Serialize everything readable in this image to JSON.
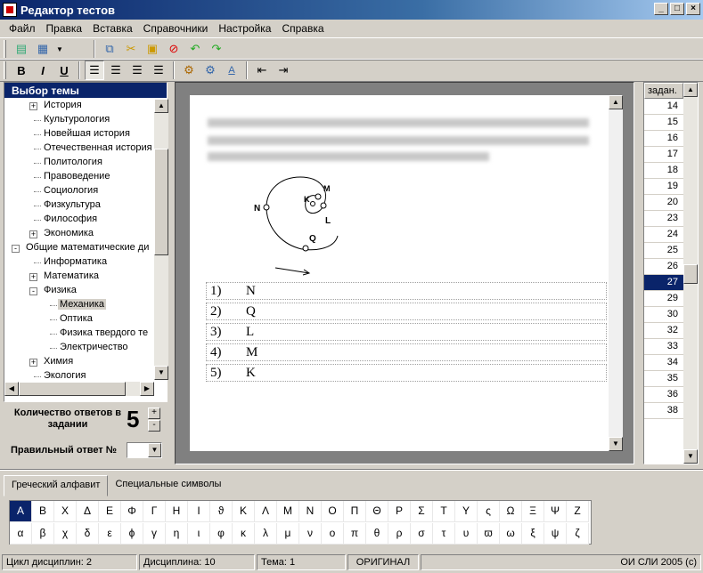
{
  "window": {
    "title": "Редактор тестов"
  },
  "menu": [
    "Файл",
    "Правка",
    "Вставка",
    "Справочники",
    "Настройка",
    "Справка"
  ],
  "left_panel": {
    "header": "Выбор темы",
    "tree": [
      {
        "label": "История",
        "level": 1,
        "expander": "+"
      },
      {
        "label": "Культурология",
        "level": 1
      },
      {
        "label": "Новейшая история",
        "level": 1
      },
      {
        "label": "Отечественная история",
        "level": 1
      },
      {
        "label": "Политология",
        "level": 1
      },
      {
        "label": "Правоведение",
        "level": 1
      },
      {
        "label": "Социология",
        "level": 1
      },
      {
        "label": "Физкультура",
        "level": 1
      },
      {
        "label": "Философия",
        "level": 1
      },
      {
        "label": "Экономика",
        "level": 1,
        "expander": "+"
      },
      {
        "label": "Общие математические ди",
        "level": 0,
        "expander": "-"
      },
      {
        "label": "Информатика",
        "level": 1
      },
      {
        "label": "Математика",
        "level": 1,
        "expander": "+"
      },
      {
        "label": "Физика",
        "level": 1,
        "expander": "-"
      },
      {
        "label": "Механика",
        "level": 2,
        "selected": true
      },
      {
        "label": "Оптика",
        "level": 2
      },
      {
        "label": "Физика твердого те",
        "level": 2
      },
      {
        "label": "Электричество",
        "level": 2
      },
      {
        "label": "Химия",
        "level": 1,
        "expander": "+"
      },
      {
        "label": "Экология",
        "level": 1
      }
    ],
    "answers_count_label": "Количество ответов в задании",
    "answers_count": "5",
    "correct_label": "Правильный ответ №",
    "correct_value": ""
  },
  "question": {
    "diagram_labels": [
      "N",
      "K",
      "M",
      "L",
      "Q"
    ],
    "options": [
      {
        "num": "1)",
        "text": "N"
      },
      {
        "num": "2)",
        "text": "Q"
      },
      {
        "num": "3)",
        "text": "L"
      },
      {
        "num": "4)",
        "text": "M"
      },
      {
        "num": "5)",
        "text": "K"
      }
    ]
  },
  "tasks": {
    "header": "задан.",
    "items": [
      "14",
      "15",
      "16",
      "17",
      "18",
      "19",
      "20",
      "23",
      "24",
      "25",
      "26",
      "27",
      "29",
      "30",
      "32",
      "33",
      "34",
      "35",
      "36",
      "38"
    ],
    "selected": "27"
  },
  "tabs": [
    "Греческий алфавит",
    "Специальные символы"
  ],
  "greek_upper": [
    "Α",
    "Β",
    "Χ",
    "Δ",
    "Ε",
    "Φ",
    "Γ",
    "Η",
    "Ι",
    "ϑ",
    "Κ",
    "Λ",
    "Μ",
    "Ν",
    "Ο",
    "Π",
    "Θ",
    "Ρ",
    "Σ",
    "Τ",
    "Υ",
    "ς",
    "Ω",
    "Ξ",
    "Ψ",
    "Ζ"
  ],
  "greek_lower": [
    "α",
    "β",
    "χ",
    "δ",
    "ε",
    "ϕ",
    "γ",
    "η",
    "ι",
    "φ",
    "κ",
    "λ",
    "μ",
    "ν",
    "ο",
    "π",
    "θ",
    "ρ",
    "σ",
    "τ",
    "υ",
    "ϖ",
    "ω",
    "ξ",
    "ψ",
    "ζ"
  ],
  "status": [
    "Цикл дисциплин: 2",
    "Дисциплина: 10",
    "Тема: 1",
    "ОРИГИНАЛ",
    "ОИ СЛИ 2005 (с)"
  ],
  "window_buttons": [
    "_",
    "□",
    "×"
  ]
}
